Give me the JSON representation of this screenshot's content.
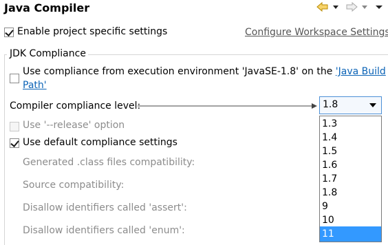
{
  "header": {
    "title": "Java Compiler"
  },
  "nav_icons": [
    "back-arrow-icon",
    "chevron-down-icon",
    "forward-arrow-icon",
    "chevron-down-icon",
    "menu-icon"
  ],
  "enable_project": {
    "label": "Enable project specific settings",
    "checked": true
  },
  "configure_link": "Configure Workspace Settings...",
  "jdk_group": {
    "title": "JDK Compliance"
  },
  "use_env": {
    "label": "Use compliance from execution environment 'JavaSE-1.8' on the ",
    "link_part1": "'Java Build",
    "link_part2": "Path'",
    "checked": false
  },
  "compliance": {
    "label": "Compiler compliance level:",
    "value": "1.8"
  },
  "release_option": {
    "label": "Use '--release' option",
    "checked": false,
    "enabled": false
  },
  "use_default": {
    "label": "Use default compliance settings",
    "checked": true
  },
  "disabled_settings": [
    "Generated .class files compatibility:",
    "Source compatibility:",
    "Disallow identifiers called 'assert':",
    "Disallow identifiers called 'enum':"
  ],
  "dropdown": {
    "options": [
      "1.3",
      "1.4",
      "1.5",
      "1.6",
      "1.7",
      "1.8",
      "9",
      "10",
      "11"
    ],
    "highlighted": "11"
  },
  "colors": {
    "link": "#0b63b6",
    "selection": "#3399ff",
    "nav_arrow": "#e0a400",
    "disabled": "#8c8c8c"
  }
}
